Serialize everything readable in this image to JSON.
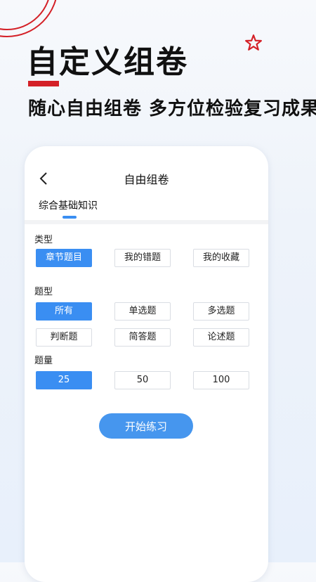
{
  "promo": {
    "headline": "自定义组卷",
    "subline": "随心自由组卷  多方位检验复习成果",
    "accent_color": "#d42027"
  },
  "screen": {
    "title": "自由组卷",
    "tab": "综合基础知识",
    "sections": {
      "type": {
        "label": "类型",
        "options": [
          "章节题目",
          "我的错题",
          "我的收藏"
        ],
        "selected": "章节题目"
      },
      "question_type": {
        "label": "题型",
        "options": [
          "所有",
          "单选题",
          "多选题",
          "判断题",
          "简答题",
          "论述题"
        ],
        "selected": "所有"
      },
      "quantity": {
        "label": "题量",
        "options": [
          "25",
          "50",
          "100"
        ],
        "selected": "25"
      }
    },
    "start_button": "开始练习",
    "accent_color": "#3a8ef2"
  }
}
